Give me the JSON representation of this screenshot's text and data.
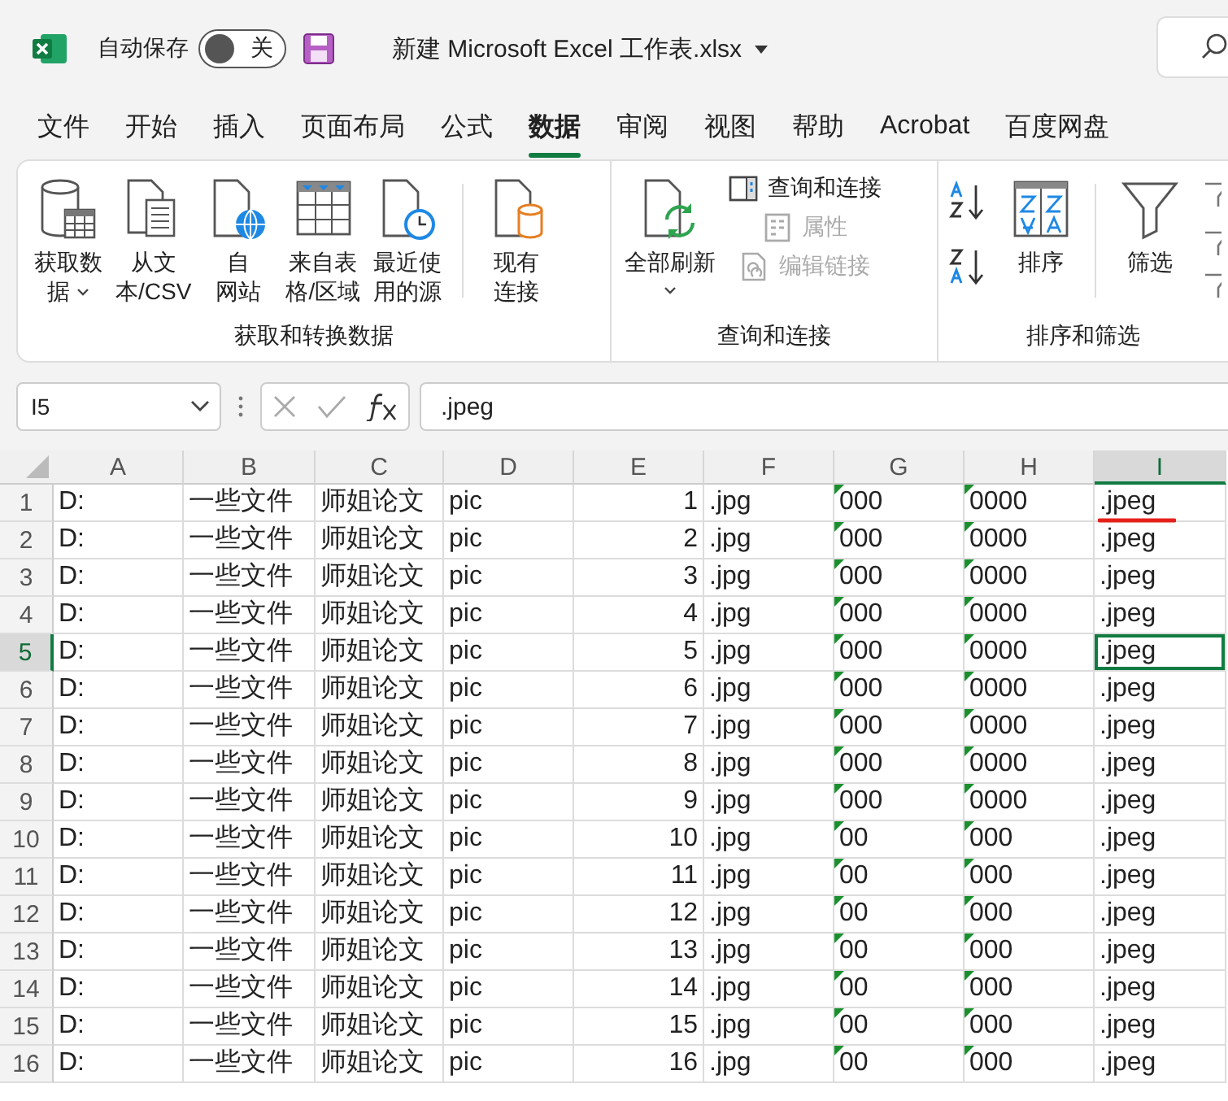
{
  "title_bar": {
    "autosave_label": "自动保存",
    "autosave": {
      "on": false,
      "label": "关"
    },
    "document_title": "新建 Microsoft Excel 工作表.xlsx"
  },
  "tabs": [
    {
      "label": "文件",
      "selected": false
    },
    {
      "label": "开始",
      "selected": false
    },
    {
      "label": "插入",
      "selected": false
    },
    {
      "label": "页面布局",
      "selected": false
    },
    {
      "label": "公式",
      "selected": false
    },
    {
      "label": "数据",
      "selected": true
    },
    {
      "label": "审阅",
      "selected": false
    },
    {
      "label": "视图",
      "selected": false
    },
    {
      "label": "帮助",
      "selected": false
    },
    {
      "label": "Acrobat",
      "selected": false
    },
    {
      "label": "百度网盘",
      "selected": false
    }
  ],
  "ribbon": {
    "groups": [
      {
        "label": "获取和转换数据",
        "buttons": [
          {
            "kind": "large",
            "lines": [
              "获取数",
              "据"
            ],
            "dropdown": true
          },
          {
            "kind": "large",
            "lines": [
              "从文",
              "本/CSV"
            ],
            "dropdown": false
          },
          {
            "kind": "large",
            "lines": [
              "自",
              "网站"
            ],
            "dropdown": false
          },
          {
            "kind": "large",
            "lines": [
              "来自表",
              "格/区域"
            ],
            "dropdown": false
          },
          {
            "kind": "large",
            "lines": [
              "最近使",
              "用的源"
            ],
            "dropdown": false
          },
          {
            "kind": "separator"
          },
          {
            "kind": "large",
            "lines": [
              "现有",
              "连接"
            ],
            "dropdown": false
          }
        ]
      },
      {
        "label": "查询和连接",
        "buttons": [
          {
            "kind": "large",
            "lines": [
              "全部刷新"
            ],
            "dropdown": true
          },
          {
            "kind": "small",
            "label": "查询和连接",
            "disabled": false
          },
          {
            "kind": "small",
            "label": "属性",
            "disabled": true
          },
          {
            "kind": "small",
            "label": "编辑链接",
            "disabled": true
          }
        ]
      },
      {
        "label": "排序和筛选",
        "buttons": [
          {
            "kind": "icon"
          },
          {
            "kind": "icon"
          },
          {
            "kind": "large",
            "lines": [
              "排序"
            ],
            "dropdown": false
          },
          {
            "kind": "separator"
          },
          {
            "kind": "large",
            "lines": [
              "筛选"
            ],
            "dropdown": false
          }
        ]
      }
    ]
  },
  "formula_bar": {
    "name_box": "I5",
    "formula": ".jpeg"
  },
  "sheet": {
    "columns": [
      {
        "label": "A",
        "selected": false,
        "kind": "text",
        "error_marker": false
      },
      {
        "label": "B",
        "selected": false,
        "kind": "text",
        "error_marker": false
      },
      {
        "label": "C",
        "selected": false,
        "kind": "text",
        "error_marker": false
      },
      {
        "label": "D",
        "selected": false,
        "kind": "text",
        "error_marker": false
      },
      {
        "label": "E",
        "selected": false,
        "kind": "number",
        "error_marker": false
      },
      {
        "label": "F",
        "selected": false,
        "kind": "text",
        "error_marker": false
      },
      {
        "label": "G",
        "selected": false,
        "kind": "text",
        "error_marker": true
      },
      {
        "label": "H",
        "selected": false,
        "kind": "text",
        "error_marker": true
      },
      {
        "label": "I",
        "selected": true,
        "kind": "text",
        "error_marker": false
      }
    ],
    "rows": [
      {
        "number": "1",
        "selected": false,
        "red_underline": true,
        "cells": [
          "D:",
          "一些文件",
          "师姐论文",
          "pic",
          "1",
          ".jpg",
          "000",
          "0000",
          ".jpeg"
        ]
      },
      {
        "number": "2",
        "selected": false,
        "red_underline": false,
        "cells": [
          "D:",
          "一些文件",
          "师姐论文",
          "pic",
          "2",
          ".jpg",
          "000",
          "0000",
          ".jpeg"
        ]
      },
      {
        "number": "3",
        "selected": false,
        "red_underline": false,
        "cells": [
          "D:",
          "一些文件",
          "师姐论文",
          "pic",
          "3",
          ".jpg",
          "000",
          "0000",
          ".jpeg"
        ]
      },
      {
        "number": "4",
        "selected": false,
        "red_underline": false,
        "cells": [
          "D:",
          "一些文件",
          "师姐论文",
          "pic",
          "4",
          ".jpg",
          "000",
          "0000",
          ".jpeg"
        ]
      },
      {
        "number": "5",
        "selected": true,
        "red_underline": false,
        "cells": [
          "D:",
          "一些文件",
          "师姐论文",
          "pic",
          "5",
          ".jpg",
          "000",
          "0000",
          ".jpeg"
        ]
      },
      {
        "number": "6",
        "selected": false,
        "red_underline": false,
        "cells": [
          "D:",
          "一些文件",
          "师姐论文",
          "pic",
          "6",
          ".jpg",
          "000",
          "0000",
          ".jpeg"
        ]
      },
      {
        "number": "7",
        "selected": false,
        "red_underline": false,
        "cells": [
          "D:",
          "一些文件",
          "师姐论文",
          "pic",
          "7",
          ".jpg",
          "000",
          "0000",
          ".jpeg"
        ]
      },
      {
        "number": "8",
        "selected": false,
        "red_underline": false,
        "cells": [
          "D:",
          "一些文件",
          "师姐论文",
          "pic",
          "8",
          ".jpg",
          "000",
          "0000",
          ".jpeg"
        ]
      },
      {
        "number": "9",
        "selected": false,
        "red_underline": false,
        "cells": [
          "D:",
          "一些文件",
          "师姐论文",
          "pic",
          "9",
          ".jpg",
          "000",
          "0000",
          ".jpeg"
        ]
      },
      {
        "number": "10",
        "selected": false,
        "red_underline": false,
        "cells": [
          "D:",
          "一些文件",
          "师姐论文",
          "pic",
          "10",
          ".jpg",
          "00",
          "000",
          ".jpeg"
        ]
      },
      {
        "number": "11",
        "selected": false,
        "red_underline": false,
        "cells": [
          "D:",
          "一些文件",
          "师姐论文",
          "pic",
          "11",
          ".jpg",
          "00",
          "000",
          ".jpeg"
        ]
      },
      {
        "number": "12",
        "selected": false,
        "red_underline": false,
        "cells": [
          "D:",
          "一些文件",
          "师姐论文",
          "pic",
          "12",
          ".jpg",
          "00",
          "000",
          ".jpeg"
        ]
      },
      {
        "number": "13",
        "selected": false,
        "red_underline": false,
        "cells": [
          "D:",
          "一些文件",
          "师姐论文",
          "pic",
          "13",
          ".jpg",
          "00",
          "000",
          ".jpeg"
        ]
      },
      {
        "number": "14",
        "selected": false,
        "red_underline": false,
        "cells": [
          "D:",
          "一些文件",
          "师姐论文",
          "pic",
          "14",
          ".jpg",
          "00",
          "000",
          ".jpeg"
        ]
      },
      {
        "number": "15",
        "selected": false,
        "red_underline": false,
        "cells": [
          "D:",
          "一些文件",
          "师姐论文",
          "pic",
          "15",
          ".jpg",
          "00",
          "000",
          ".jpeg"
        ]
      },
      {
        "number": "16",
        "selected": false,
        "red_underline": false,
        "cells": [
          "D:",
          "一些文件",
          "师姐论文",
          "pic",
          "16",
          ".jpg",
          "00",
          "000",
          ".jpeg"
        ]
      }
    ]
  }
}
